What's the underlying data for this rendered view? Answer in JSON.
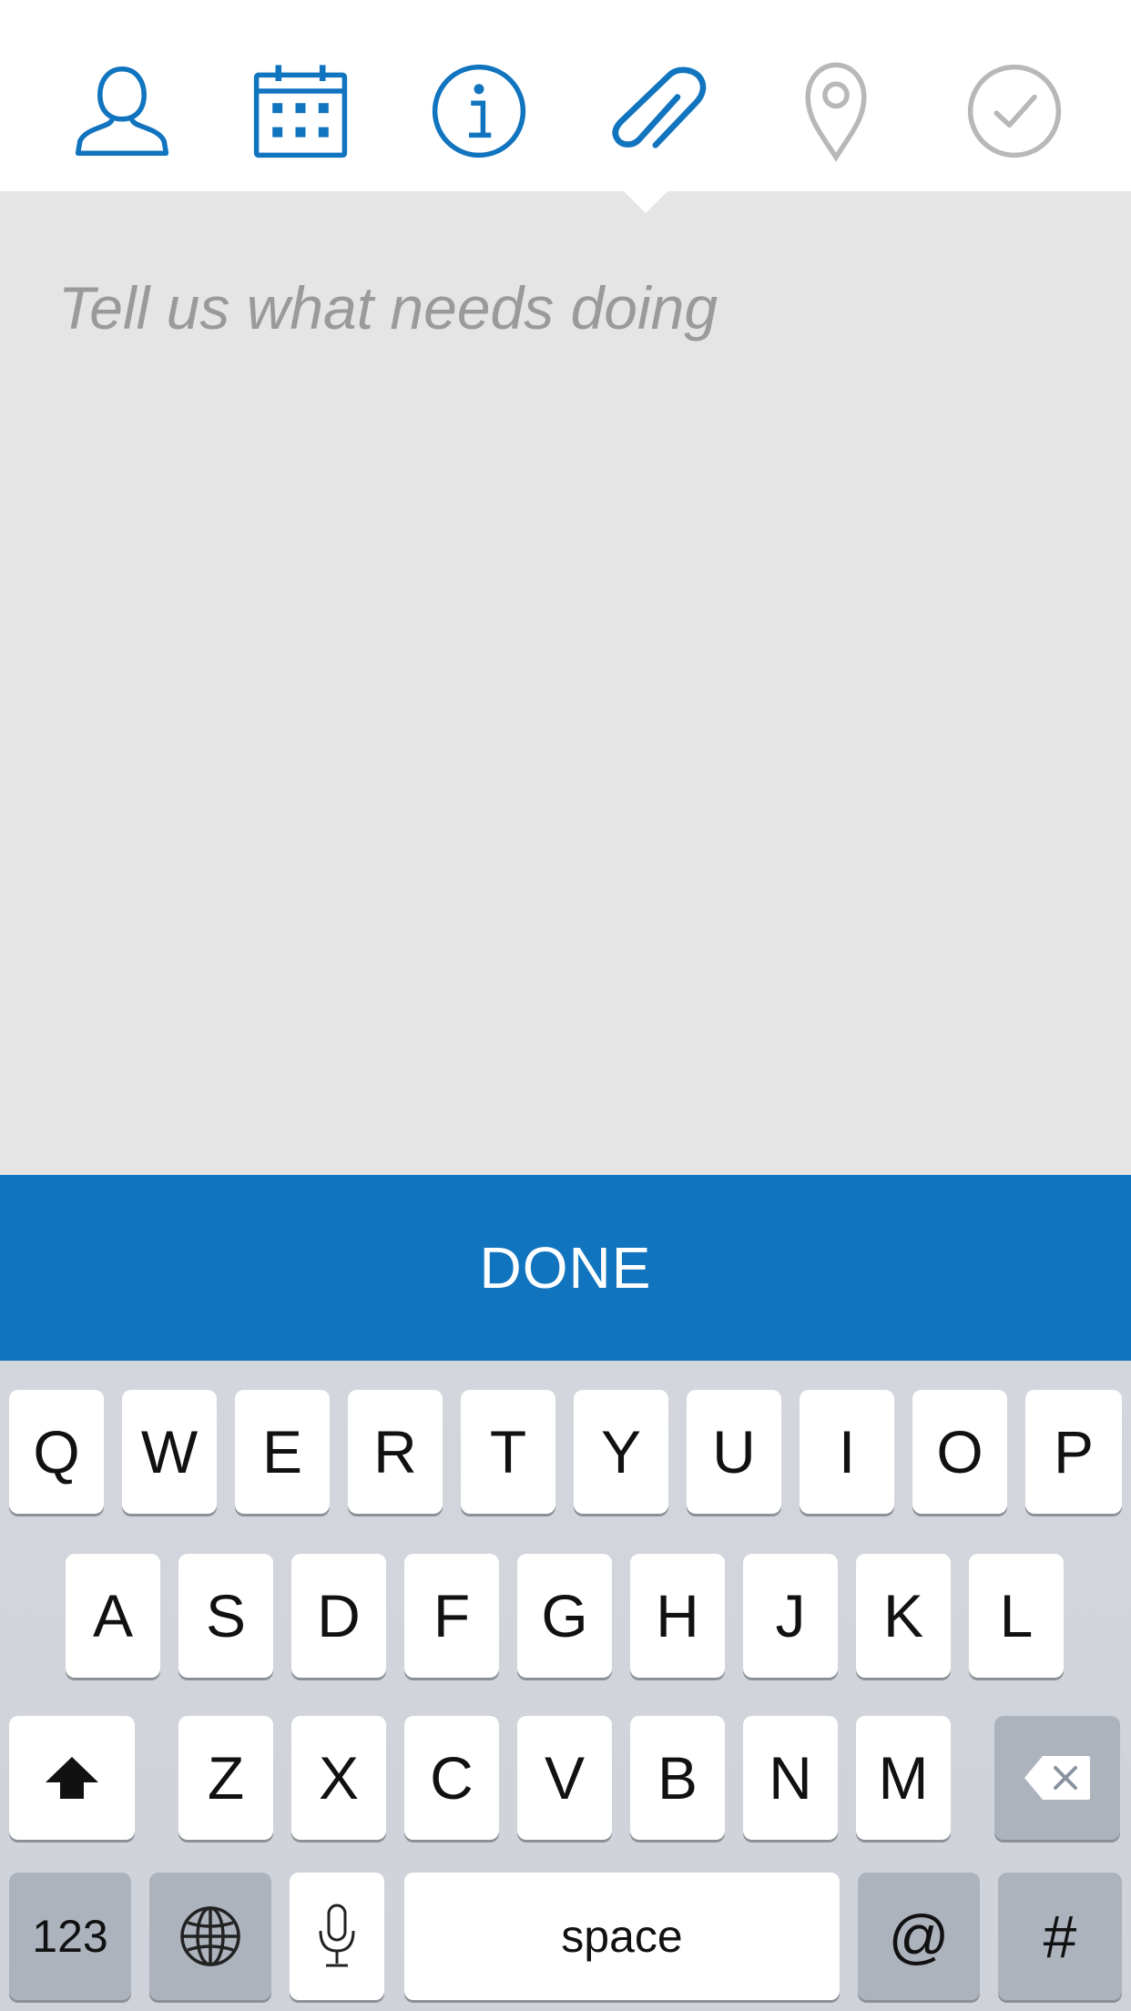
{
  "toolbar": {
    "icons": [
      "person-icon",
      "calendar-icon",
      "info-icon",
      "paperclip-icon",
      "location-pin-icon",
      "checkmark-circle-icon"
    ],
    "active_color": "#1174bf",
    "inactive_color": "#b8b8b8"
  },
  "editor": {
    "placeholder": "Tell us what needs doing",
    "value": ""
  },
  "done_label": "DONE",
  "keyboard": {
    "row1": [
      "Q",
      "W",
      "E",
      "R",
      "T",
      "Y",
      "U",
      "I",
      "O",
      "P"
    ],
    "row2": [
      "A",
      "S",
      "D",
      "F",
      "G",
      "H",
      "J",
      "K",
      "L"
    ],
    "row3": [
      "Z",
      "X",
      "C",
      "V",
      "B",
      "N",
      "M"
    ],
    "shift_icon": "shift-arrow-icon",
    "delete_icon": "backspace-icon",
    "numbers_label": "123",
    "globe_icon": "globe-icon",
    "mic_icon": "microphone-icon",
    "space_label": "space",
    "at_label": "@",
    "hash_label": "#"
  },
  "colors": {
    "accent": "#1174bf",
    "editor_bg": "#e5e5e6",
    "keyboard_bg": "#d1d5db",
    "dark_key": "#acb3bd"
  }
}
